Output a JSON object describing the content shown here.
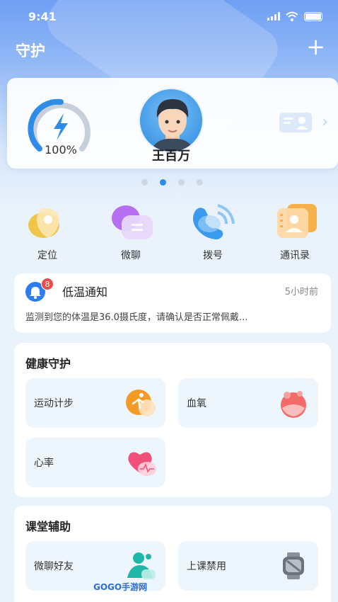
{
  "status": {
    "time": "9:41"
  },
  "header": {
    "title": "守护",
    "add_label": "+"
  },
  "profile": {
    "battery": "100%",
    "name": "王百万"
  },
  "quick_actions": [
    {
      "label": "定位"
    },
    {
      "label": "微聊"
    },
    {
      "label": "拨号"
    },
    {
      "label": "通讯录"
    }
  ],
  "notice": {
    "badge": "8",
    "title": "低温通知",
    "time": "5小时前",
    "body": "监测到您的体温是36.0摄氏度，请确认是否正常佩戴..."
  },
  "health": {
    "title": "健康守护",
    "tiles": [
      {
        "label": "运动计步"
      },
      {
        "label": "血氧"
      },
      {
        "label": "心率"
      }
    ]
  },
  "classroom": {
    "title": "课堂辅助",
    "tiles": [
      {
        "label": "微聊好友"
      },
      {
        "label": "上课禁用"
      }
    ]
  },
  "watermark": "GOGO手游网",
  "colors": {
    "accent": "#2e8ce6",
    "badge": "#f04a4a"
  }
}
